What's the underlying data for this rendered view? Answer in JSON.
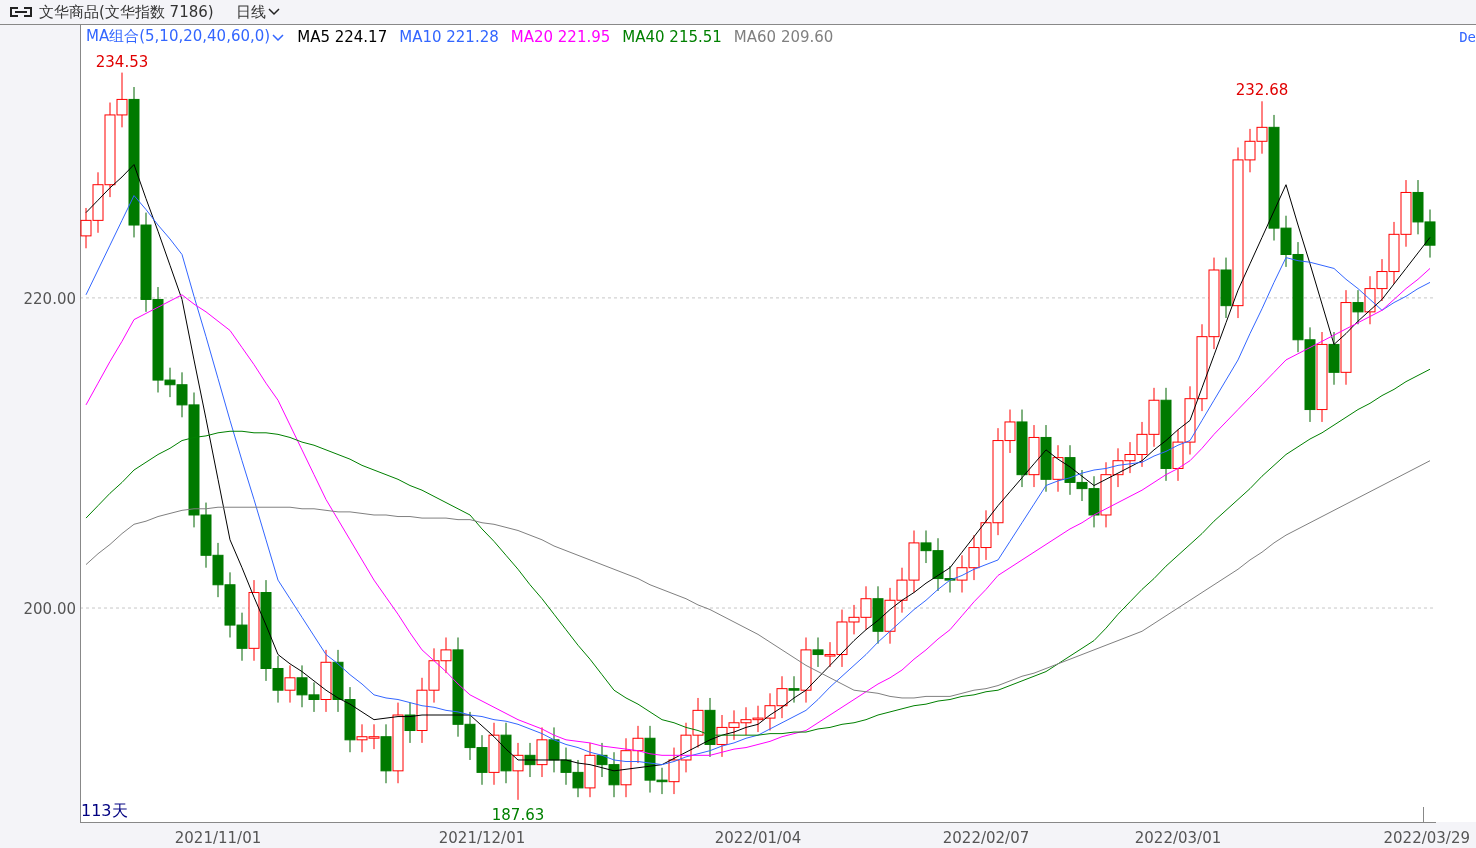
{
  "header": {
    "title": "文华商品(文华指数  7186)",
    "period": "日线"
  },
  "legend": {
    "label": "MA组合(5,10,20,40,60,0)",
    "values": [
      "224.17",
      "221.28",
      "221.95",
      "215.51",
      "209.60"
    ],
    "cut_text": "De"
  },
  "day_count": "113天",
  "chart_data": {
    "type": "candlestick",
    "categories": [
      null,
      null,
      null,
      null,
      null,
      null,
      null,
      null,
      null,
      null,
      null,
      "2021/11/01",
      null,
      null,
      null,
      null,
      null,
      null,
      null,
      null,
      null,
      null,
      null,
      null,
      null,
      null,
      null,
      null,
      null,
      null,
      null,
      null,
      null,
      "2021/12/01",
      null,
      null,
      null,
      null,
      null,
      null,
      null,
      null,
      null,
      null,
      null,
      null,
      null,
      null,
      null,
      null,
      null,
      null,
      null,
      null,
      null,
      null,
      "2022/01/04",
      null,
      null,
      null,
      null,
      null,
      null,
      null,
      null,
      null,
      null,
      null,
      null,
      null,
      null,
      null,
      null,
      null,
      null,
      "2022/02/07",
      null,
      null,
      null,
      null,
      null,
      null,
      null,
      null,
      null,
      null,
      null,
      null,
      null,
      null,
      null,
      "2022/03/01",
      null,
      null,
      null,
      null,
      null,
      null,
      null,
      null,
      null,
      null,
      null,
      null,
      null,
      null,
      null,
      null,
      null,
      null,
      null,
      null,
      "2022/03/29"
    ],
    "ylim": [
      186.2,
      237.6
    ],
    "yticks": [
      {
        "value": 200,
        "label": "200.00"
      },
      {
        "value": 220,
        "label": "220.00"
      }
    ],
    "ohlc": [
      [
        224.0,
        225.8,
        223.2,
        225.0
      ],
      [
        225.0,
        228.1,
        224.2,
        227.3
      ],
      [
        227.3,
        232.6,
        226.5,
        231.8
      ],
      [
        231.8,
        234.53,
        231.0,
        232.8
      ],
      [
        232.8,
        233.6,
        223.9,
        224.7
      ],
      [
        224.7,
        225.5,
        219.1,
        219.9
      ],
      [
        219.9,
        220.7,
        213.9,
        214.7
      ],
      [
        214.7,
        215.5,
        213.6,
        214.4
      ],
      [
        214.4,
        215.2,
        212.3,
        213.1
      ],
      [
        213.1,
        213.9,
        205.2,
        206.0
      ],
      [
        206.0,
        206.8,
        202.6,
        203.4
      ],
      [
        203.4,
        204.2,
        200.7,
        201.5
      ],
      [
        201.5,
        202.3,
        198.1,
        198.9
      ],
      [
        198.9,
        199.7,
        196.6,
        197.4
      ],
      [
        197.4,
        201.8,
        196.6,
        201.0
      ],
      [
        201.0,
        201.8,
        195.3,
        196.1
      ],
      [
        196.1,
        196.9,
        193.9,
        194.7
      ],
      [
        194.7,
        196.3,
        193.9,
        195.5
      ],
      [
        195.5,
        196.3,
        193.6,
        194.4
      ],
      [
        194.4,
        195.2,
        193.3,
        194.1
      ],
      [
        194.1,
        197.3,
        193.3,
        196.5
      ],
      [
        196.5,
        197.3,
        193.3,
        194.1
      ],
      [
        194.1,
        194.9,
        190.7,
        191.5
      ],
      [
        191.5,
        192.5,
        190.7,
        191.7
      ],
      [
        191.7,
        192.5,
        190.9,
        191.7
      ],
      [
        191.7,
        192.5,
        188.7,
        189.5
      ],
      [
        189.5,
        193.9,
        188.7,
        193.1
      ],
      [
        193.1,
        193.9,
        191.3,
        192.1
      ],
      [
        192.1,
        195.5,
        191.3,
        194.7
      ],
      [
        194.7,
        197.4,
        193.9,
        196.6
      ],
      [
        196.6,
        198.1,
        195.8,
        197.3
      ],
      [
        197.3,
        198.1,
        191.7,
        192.5
      ],
      [
        192.5,
        193.3,
        190.2,
        191.0
      ],
      [
        191.0,
        191.8,
        188.6,
        189.4
      ],
      [
        189.4,
        192.6,
        188.6,
        191.8
      ],
      [
        191.8,
        192.6,
        188.7,
        189.5
      ],
      [
        189.5,
        191.3,
        187.63,
        190.5
      ],
      [
        190.5,
        191.3,
        189.1,
        189.9
      ],
      [
        189.9,
        192.3,
        189.1,
        191.5
      ],
      [
        191.5,
        192.3,
        189.4,
        190.2
      ],
      [
        190.2,
        191.0,
        188.6,
        189.4
      ],
      [
        189.4,
        190.2,
        187.8,
        188.4
      ],
      [
        188.4,
        191.3,
        187.8,
        190.5
      ],
      [
        190.5,
        191.3,
        189.1,
        189.9
      ],
      [
        189.9,
        190.7,
        187.8,
        188.6
      ],
      [
        188.6,
        191.6,
        187.8,
        190.8
      ],
      [
        190.8,
        192.4,
        190.0,
        191.6
      ],
      [
        191.6,
        192.4,
        188.1,
        188.9
      ],
      [
        188.9,
        189.7,
        188.0,
        188.8
      ],
      [
        188.8,
        191.0,
        188.0,
        190.2
      ],
      [
        190.2,
        192.6,
        189.4,
        191.8
      ],
      [
        191.8,
        194.2,
        191.0,
        193.4
      ],
      [
        193.4,
        194.2,
        190.4,
        191.2
      ],
      [
        191.2,
        193.1,
        190.4,
        192.3
      ],
      [
        192.3,
        193.4,
        191.5,
        192.6
      ],
      [
        192.6,
        193.6,
        191.8,
        192.8
      ],
      [
        192.8,
        193.7,
        192.0,
        192.9
      ],
      [
        192.9,
        194.5,
        192.1,
        193.7
      ],
      [
        193.7,
        195.6,
        192.9,
        194.8
      ],
      [
        194.8,
        195.6,
        193.9,
        194.7
      ],
      [
        194.7,
        198.1,
        193.9,
        197.3
      ],
      [
        197.3,
        198.1,
        196.2,
        197.0
      ],
      [
        197.0,
        197.8,
        196.2,
        197.0
      ],
      [
        197.0,
        199.9,
        196.2,
        199.1
      ],
      [
        199.1,
        200.2,
        198.3,
        199.4
      ],
      [
        199.4,
        201.4,
        198.6,
        200.6
      ],
      [
        200.6,
        201.4,
        197.7,
        198.5
      ],
      [
        198.5,
        201.3,
        197.7,
        200.5
      ],
      [
        200.5,
        202.6,
        199.7,
        201.8
      ],
      [
        201.8,
        205.0,
        201.0,
        204.2
      ],
      [
        204.2,
        205.0,
        202.9,
        203.7
      ],
      [
        203.7,
        204.5,
        201.1,
        201.9
      ],
      [
        201.9,
        202.7,
        201.0,
        201.8
      ],
      [
        201.8,
        203.4,
        201.0,
        202.6
      ],
      [
        202.6,
        204.7,
        201.8,
        203.9
      ],
      [
        203.9,
        206.3,
        203.1,
        205.5
      ],
      [
        205.5,
        211.6,
        204.7,
        210.8
      ],
      [
        210.8,
        212.8,
        210.0,
        212.0
      ],
      [
        212.0,
        212.8,
        207.8,
        208.6
      ],
      [
        208.6,
        211.8,
        207.8,
        211.0
      ],
      [
        211.0,
        211.8,
        207.5,
        208.3
      ],
      [
        208.3,
        210.5,
        207.5,
        209.7
      ],
      [
        209.7,
        210.5,
        207.3,
        208.1
      ],
      [
        208.1,
        208.9,
        206.9,
        207.7
      ],
      [
        207.7,
        208.5,
        205.2,
        206.0
      ],
      [
        206.0,
        209.4,
        205.2,
        208.6
      ],
      [
        208.6,
        210.3,
        207.8,
        209.5
      ],
      [
        209.5,
        210.7,
        208.7,
        209.9
      ],
      [
        209.9,
        212.0,
        209.1,
        211.2
      ],
      [
        211.2,
        214.2,
        210.4,
        213.4
      ],
      [
        213.4,
        214.2,
        208.2,
        209.0
      ],
      [
        209.0,
        211.5,
        208.2,
        210.7
      ],
      [
        210.7,
        214.3,
        209.9,
        213.5
      ],
      [
        213.5,
        218.3,
        212.7,
        217.5
      ],
      [
        217.5,
        222.6,
        216.7,
        221.8
      ],
      [
        221.8,
        222.6,
        218.7,
        219.5
      ],
      [
        219.5,
        229.7,
        218.7,
        228.9
      ],
      [
        228.9,
        230.9,
        228.1,
        230.1
      ],
      [
        230.1,
        232.68,
        229.3,
        231.0
      ],
      [
        231.0,
        231.8,
        223.7,
        224.5
      ],
      [
        224.5,
        225.3,
        222.0,
        222.8
      ],
      [
        222.8,
        223.6,
        216.5,
        217.3
      ],
      [
        217.3,
        218.1,
        212.0,
        212.8
      ],
      [
        212.8,
        217.8,
        212.0,
        217.0
      ],
      [
        217.0,
        217.8,
        214.4,
        215.2
      ],
      [
        215.2,
        220.5,
        214.4,
        219.7
      ],
      [
        219.7,
        220.5,
        218.3,
        219.1
      ],
      [
        219.1,
        221.4,
        218.3,
        220.6
      ],
      [
        220.6,
        222.5,
        219.8,
        221.7
      ],
      [
        221.7,
        224.9,
        220.9,
        224.1
      ],
      [
        224.1,
        227.6,
        223.3,
        226.8
      ],
      [
        226.8,
        227.6,
        224.1,
        224.9
      ],
      [
        224.9,
        225.7,
        222.6,
        223.4
      ]
    ],
    "series": [
      {
        "name": "MA5",
        "type": "line",
        "color": "#000000",
        "values": [
          225.5,
          226.3,
          227.1,
          227.8,
          228.6,
          226.4,
          224.3,
          222.1,
          219.9,
          216.0,
          212.2,
          208.3,
          204.4,
          202.6,
          200.7,
          198.9,
          197.0,
          196.4,
          195.9,
          195.3,
          194.7,
          194.2,
          193.8,
          193.3,
          192.8,
          192.9,
          193.0,
          193.0,
          193.1,
          193.1,
          193.1,
          193.1,
          193.1,
          192.4,
          191.7,
          190.9,
          190.2,
          190.2,
          190.2,
          190.2,
          190.2,
          190.0,
          189.9,
          189.7,
          189.5,
          189.6,
          189.7,
          189.8,
          189.9,
          190.3,
          190.7,
          191.1,
          191.5,
          191.8,
          192.0,
          192.3,
          192.5,
          193.1,
          193.6,
          194.2,
          194.7,
          195.5,
          196.3,
          197.1,
          197.9,
          198.6,
          199.2,
          199.9,
          200.5,
          201.0,
          201.6,
          202.1,
          202.6,
          203.6,
          204.6,
          205.6,
          206.6,
          207.5,
          208.4,
          209.3,
          210.2,
          209.6,
          209.1,
          208.5,
          207.9,
          208.3,
          208.7,
          209.1,
          209.5,
          210.2,
          210.8,
          211.5,
          212.1,
          214.2,
          216.3,
          218.4,
          220.5,
          222.2,
          223.9,
          225.6,
          227.3,
          224.7,
          222.2,
          219.6,
          217.0,
          217.7,
          218.5,
          219.2,
          219.9,
          220.9,
          221.9,
          222.9,
          223.9
        ]
      },
      {
        "name": "MA10",
        "type": "line",
        "color": "#3366ff",
        "values": [
          220.2,
          221.8,
          223.4,
          225.0,
          226.6,
          225.7,
          224.7,
          223.8,
          222.8,
          220.1,
          217.5,
          214.8,
          212.1,
          209.5,
          207.0,
          204.4,
          201.8,
          200.6,
          199.4,
          198.2,
          197.0,
          196.4,
          195.7,
          195.1,
          194.4,
          194.2,
          194.1,
          193.9,
          193.7,
          193.6,
          193.4,
          193.3,
          193.1,
          193.0,
          192.8,
          192.7,
          192.5,
          192.2,
          191.9,
          191.5,
          191.2,
          191.0,
          190.7,
          190.5,
          190.2,
          190.1,
          190.1,
          190.0,
          189.9,
          190.1,
          190.4,
          190.6,
          190.8,
          191.1,
          191.3,
          191.6,
          191.8,
          192.2,
          192.6,
          193.0,
          193.4,
          194.1,
          194.9,
          195.6,
          196.3,
          197.0,
          197.8,
          198.5,
          199.2,
          199.9,
          200.5,
          201.2,
          201.8,
          202.1,
          202.5,
          202.8,
          203.1,
          204.3,
          205.5,
          206.7,
          207.9,
          208.2,
          208.4,
          208.7,
          208.9,
          209.0,
          209.2,
          209.3,
          209.4,
          209.8,
          210.1,
          210.5,
          210.8,
          212.1,
          213.4,
          214.7,
          216.0,
          217.7,
          219.3,
          221.0,
          222.6,
          222.4,
          222.3,
          222.1,
          221.9,
          221.2,
          220.6,
          219.9,
          219.2,
          219.7,
          220.1,
          220.6,
          221.0
        ]
      },
      {
        "name": "MA20",
        "type": "line",
        "color": "#ff00ff",
        "values": [
          213.1,
          214.5,
          215.9,
          217.2,
          218.6,
          219.0,
          219.4,
          219.8,
          220.2,
          219.6,
          219.1,
          218.5,
          217.9,
          216.8,
          215.7,
          214.5,
          213.4,
          211.8,
          210.2,
          208.6,
          207.0,
          205.7,
          204.4,
          203.1,
          201.8,
          200.7,
          199.6,
          198.4,
          197.3,
          196.6,
          195.9,
          195.1,
          194.4,
          194.0,
          193.6,
          193.2,
          192.8,
          192.5,
          192.2,
          191.8,
          191.5,
          191.4,
          191.3,
          191.1,
          191.0,
          190.9,
          190.8,
          190.6,
          190.5,
          190.5,
          190.5,
          190.5,
          190.5,
          190.7,
          190.9,
          191.0,
          191.2,
          191.4,
          191.7,
          191.9,
          192.1,
          192.6,
          193.1,
          193.6,
          194.1,
          194.6,
          195.1,
          195.5,
          196.0,
          196.7,
          197.3,
          198.0,
          198.6,
          199.5,
          200.4,
          201.2,
          202.1,
          202.6,
          203.1,
          203.6,
          204.1,
          204.6,
          205.1,
          205.5,
          206.0,
          206.4,
          206.8,
          207.2,
          207.6,
          208.1,
          208.6,
          209.0,
          209.5,
          210.3,
          211.2,
          212.0,
          212.8,
          213.6,
          214.4,
          215.2,
          216.0,
          216.4,
          216.8,
          217.2,
          217.6,
          218.0,
          218.4,
          218.8,
          219.2,
          219.9,
          220.6,
          221.2,
          221.9
        ]
      },
      {
        "name": "MA40",
        "type": "line",
        "color": "#008000",
        "values": [
          205.8,
          206.6,
          207.4,
          208.1,
          208.9,
          209.4,
          209.9,
          210.3,
          210.8,
          211.0,
          211.1,
          211.3,
          211.4,
          211.4,
          211.3,
          211.3,
          211.2,
          211.0,
          210.7,
          210.5,
          210.2,
          209.9,
          209.6,
          209.2,
          208.9,
          208.6,
          208.3,
          207.9,
          207.6,
          207.2,
          206.8,
          206.4,
          206.0,
          205.1,
          204.3,
          203.4,
          202.5,
          201.5,
          200.6,
          199.6,
          198.6,
          197.6,
          196.7,
          195.7,
          194.7,
          194.2,
          193.8,
          193.3,
          192.8,
          192.6,
          192.3,
          192.1,
          191.8,
          191.8,
          191.8,
          191.8,
          191.8,
          191.9,
          191.9,
          192.0,
          192.0,
          192.2,
          192.3,
          192.5,
          192.6,
          192.8,
          193.1,
          193.3,
          193.5,
          193.7,
          193.8,
          194.0,
          194.1,
          194.3,
          194.4,
          194.6,
          194.7,
          195.0,
          195.3,
          195.6,
          195.9,
          196.4,
          196.9,
          197.4,
          197.9,
          198.7,
          199.6,
          200.4,
          201.2,
          201.9,
          202.7,
          203.4,
          204.1,
          204.8,
          205.6,
          206.3,
          207.0,
          207.7,
          208.5,
          209.2,
          209.9,
          210.4,
          210.9,
          211.3,
          211.8,
          212.3,
          212.8,
          213.2,
          213.7,
          214.1,
          214.6,
          215.0,
          215.4
        ]
      },
      {
        "name": "MA60",
        "type": "line",
        "color": "#808080",
        "values": [
          202.8,
          203.5,
          204.1,
          204.8,
          205.4,
          205.6,
          205.9,
          206.1,
          206.3,
          206.4,
          206.4,
          206.5,
          206.5,
          206.5,
          206.5,
          206.5,
          206.5,
          206.5,
          206.4,
          206.4,
          206.3,
          206.2,
          206.2,
          206.1,
          206.0,
          206.0,
          205.9,
          205.9,
          205.8,
          205.8,
          205.8,
          205.7,
          205.7,
          205.5,
          205.4,
          205.2,
          205.0,
          204.7,
          204.4,
          204.0,
          203.7,
          203.4,
          203.1,
          202.8,
          202.5,
          202.2,
          201.9,
          201.5,
          201.2,
          200.9,
          200.6,
          200.2,
          199.9,
          199.5,
          199.1,
          198.7,
          198.3,
          197.8,
          197.3,
          196.8,
          196.3,
          195.9,
          195.5,
          195.1,
          194.7,
          194.6,
          194.5,
          194.3,
          194.2,
          194.2,
          194.3,
          194.3,
          194.3,
          194.5,
          194.7,
          194.8,
          195.0,
          195.3,
          195.6,
          195.8,
          196.1,
          196.4,
          196.7,
          197.0,
          197.3,
          197.6,
          197.9,
          198.2,
          198.5,
          199.0,
          199.5,
          200.0,
          200.5,
          201.0,
          201.5,
          202.0,
          202.5,
          203.1,
          203.6,
          204.2,
          204.7,
          205.1,
          205.5,
          205.9,
          206.3,
          206.7,
          207.1,
          207.5,
          207.9,
          208.3,
          208.7,
          209.1,
          209.5
        ]
      }
    ],
    "annotations": [
      "234.53",
      "232.68",
      "187.63"
    ]
  }
}
